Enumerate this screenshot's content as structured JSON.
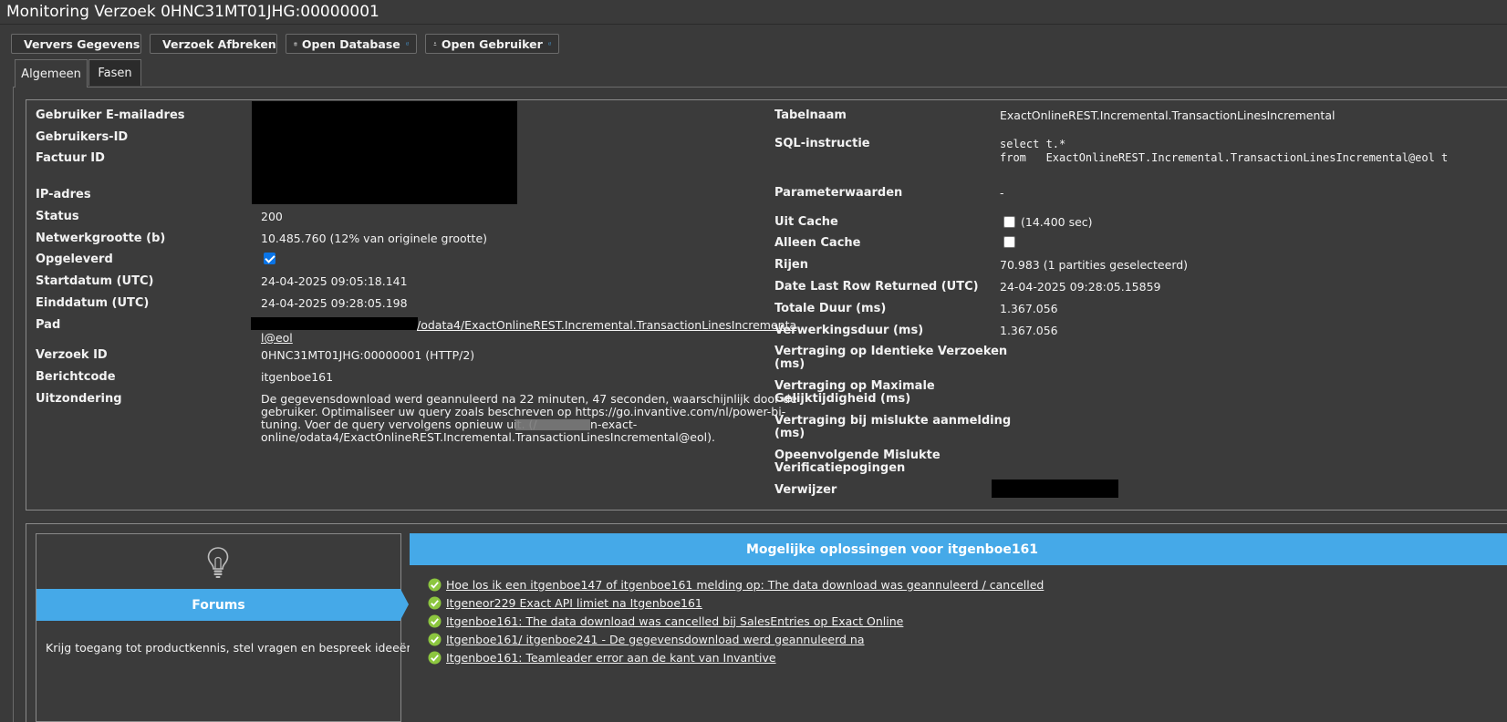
{
  "window": {
    "title": "Monitoring Verzoek 0HNC31MT01JHG:00000001"
  },
  "toolbar": {
    "refresh_label": "Ververs Gegevens",
    "abort_label": "Verzoek Afbreken",
    "open_db_label": "Open Database",
    "open_user_label": "Open Gebruiker"
  },
  "tabs": [
    {
      "label": "Algemeen",
      "active": true
    },
    {
      "label": "Fasen",
      "active": false
    }
  ],
  "left_fields": {
    "email_label": "Gebruiker E-mailadres",
    "user_id_label": "Gebruikers-ID",
    "invoice_id_label": "Factuur ID",
    "ip_label": "IP-adres",
    "status_label": "Status",
    "status_value": "200",
    "network_size_label": "Netwerkgrootte (b)",
    "network_size_value": "10.485.760 (12% van originele grootte)",
    "delivered_label": "Opgeleverd",
    "delivered_checked": true,
    "start_label": "Startdatum (UTC)",
    "start_value": "24-04-2025 09:05:18.141",
    "end_label": "Einddatum (UTC)",
    "end_value": "24-04-2025 09:28:05.198",
    "path_label": "Pad",
    "path_value_line1": "/odata4/ExactOnlineREST.Incremental.TransactionLinesIncrementa",
    "path_value_line2": "l@eol",
    "request_id_label": "Verzoek ID",
    "request_id_value": "0HNC31MT01JHG:00000001 (HTTP/2)",
    "message_code_label": "Berichtcode",
    "message_code_value": "itgenboe161",
    "exception_label": "Uitzondering",
    "exception_line1": "De gegevensdownload werd geannuleerd na 22 minuten, 47 seconden, waarschijnlijk door de",
    "exception_line2": "gebruiker. Optimaliseer uw query zoals beschreven op https://go.invantive.com/nl/power-bi-",
    "exception_line3": "tuning. Voer de query vervolgens opnieuw uit. (/",
    "exception_line3b": "n-exact-",
    "exception_line4": "online/odata4/ExactOnlineREST.Incremental.TransactionLinesIncremental@eol)."
  },
  "right_fields": {
    "table_name_label": "Tabelnaam",
    "table_name_value": "ExactOnlineREST.Incremental.TransactionLinesIncremental",
    "sql_label": "SQL-instructie",
    "sql_line1": "select t.*",
    "sql_line2": "from   ExactOnlineREST.Incremental.TransactionLinesIncremental@eol t",
    "params_label": "Parameterwaarden",
    "params_value": "-",
    "from_cache_label": "Uit Cache",
    "from_cache_checked": false,
    "from_cache_value": "(14.400 sec)",
    "cache_only_label": "Alleen Cache",
    "cache_only_checked": false,
    "rows_label": "Rijen",
    "rows_value": "70.983 (1 partities geselecteerd)",
    "last_row_label": "Date Last Row Returned (UTC)",
    "last_row_value": "24-04-2025 09:28:05.15859",
    "total_duration_label": "Totale Duur (ms)",
    "total_duration_value": "1.367.056",
    "processing_duration_label": "Verwerkingsduur (ms)",
    "processing_duration_value": "1.367.056",
    "delay_identical_label_1": "Vertraging op Identieke Verzoeken",
    "delay_identical_label_2": "(ms)",
    "delay_parallel_label_1": "Vertraging op Maximale",
    "delay_parallel_label_2": "Gelijktijdigheid (ms)",
    "delay_failed_label_1": "Vertraging bij mislukte aanmelding",
    "delay_failed_label_2": "(ms)",
    "failed_attempts_label_1": "Opeenvolgende Mislukte",
    "failed_attempts_label_2": "Verificatiepogingen",
    "referrer_label": "Verwijzer"
  },
  "forum": {
    "title": "Forums",
    "description": "Krijg toegang tot productkennis, stel vragen en bespreek ideeën.",
    "icon": "lightbulb-icon"
  },
  "solutions": {
    "title": "Mogelijke oplossingen voor itgenboe161",
    "items": [
      "Hoe los ik een itgenboe147 of itgenboe161 melding op: The data download was geannuleerd / cancelled",
      "Itgeneor229 Exact API limiet na Itgenboe161",
      "Itgenboe161: The data download was cancelled bij SalesEntries op Exact Online",
      "Itgenboe161/ itgenboe241 - De gegevensdownload werd geannuleerd na",
      "Itgenboe161: Teamleader error aan de kant van Invantive"
    ]
  },
  "colors": {
    "background": "#3a3a3a",
    "accent_blue": "#45a9e8",
    "check_green": "#8cc63f",
    "checkbox_blue": "#0a74e6"
  }
}
